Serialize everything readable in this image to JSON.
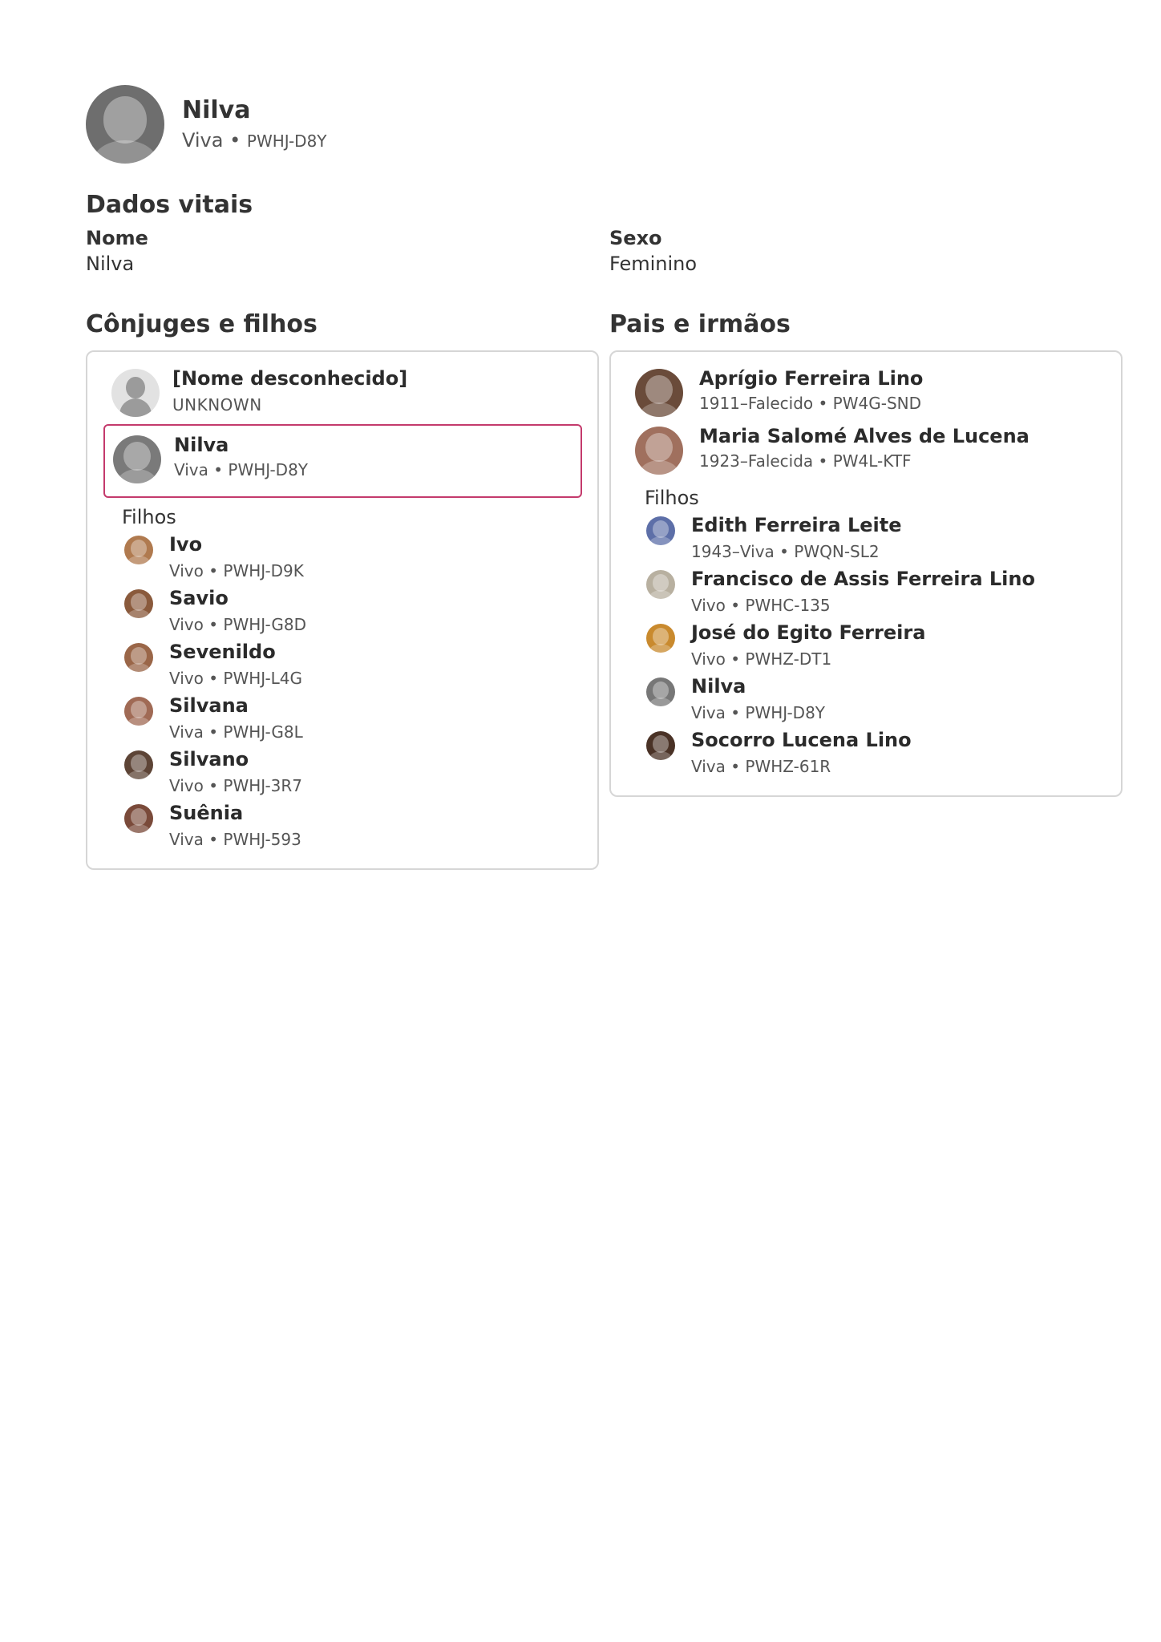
{
  "person": {
    "name": "Nilva",
    "status": "Viva",
    "separator": "•",
    "pid": "PWHJ-D8Y",
    "avatar": "portrait-photo"
  },
  "vitals": {
    "title": "Dados vitais",
    "name_label": "Nome",
    "name_value": "Nilva",
    "sex_label": "Sexo",
    "sex_value": "Feminino"
  },
  "spouses": {
    "title": "Cônjuges e filhos",
    "unknown_spouse": {
      "name": "[Nome desconhecido]",
      "sub": "UNKNOWN"
    },
    "selected_spouse": {
      "name": "Nilva",
      "sub": "Viva • PWHJ-D8Y"
    },
    "children_label": "Filhos",
    "children": [
      {
        "name": "Ivo",
        "sub": "Vivo • PWHJ-D9K",
        "color": "#b07a4f"
      },
      {
        "name": "Savio",
        "sub": "Vivo • PWHJ-G8D",
        "color": "#8a5a3c"
      },
      {
        "name": "Sevenildo",
        "sub": "Vivo • PWHJ-L4G",
        "color": "#9a6648"
      },
      {
        "name": "Silvana",
        "sub": "Viva • PWHJ-G8L",
        "color": "#a06a55"
      },
      {
        "name": "Silvano",
        "sub": "Vivo • PWHJ-3R7",
        "color": "#5d4436"
      },
      {
        "name": "Suênia",
        "sub": "Viva • PWHJ-593",
        "color": "#7a4a3a"
      }
    ]
  },
  "parents": {
    "title": "Pais e irmãos",
    "father": {
      "name": "Aprígio Ferreira Lino",
      "sub": "1911–Falecido • PW4G-SND",
      "color": "#6a4b3a"
    },
    "mother": {
      "name": "Maria Salomé Alves de Lucena",
      "sub": "1923–Falecida • PW4L-KTF",
      "color": "#a0705e"
    },
    "children_label": "Filhos",
    "children": [
      {
        "name": "Edith Ferreira Leite",
        "sub": "1943–Viva • PWQN-SL2",
        "color": "#5d6fa8"
      },
      {
        "name": "Francisco de Assis Ferreira Lino",
        "sub": "Vivo • PWHC-135",
        "color": "#b8b0a0"
      },
      {
        "name": "José do Egito Ferreira",
        "sub": "Vivo • PWHZ-DT1",
        "color": "#c98a2e"
      },
      {
        "name": "Nilva",
        "sub": "Viva • PWHJ-D8Y",
        "color": "#777777"
      },
      {
        "name": "Socorro Lucena Lino",
        "sub": "Viva • PWHZ-61R",
        "color": "#4a3226"
      }
    ]
  }
}
